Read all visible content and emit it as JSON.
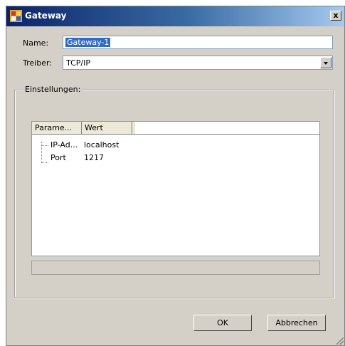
{
  "window": {
    "title": "Gateway",
    "close_label": "x"
  },
  "form": {
    "name_label": "Name:",
    "name_value": "Gateway-1",
    "driver_label": "Treiber:",
    "driver_value": "TCP/IP"
  },
  "settings": {
    "group_label": "Einstellungen:",
    "columns": [
      "Parame...",
      "Wert"
    ],
    "rows": [
      {
        "param": "IP-Ad...",
        "value": "localhost"
      },
      {
        "param": "Port",
        "value": "1217"
      }
    ]
  },
  "buttons": {
    "ok": "OK",
    "cancel": "Abbrechen"
  }
}
